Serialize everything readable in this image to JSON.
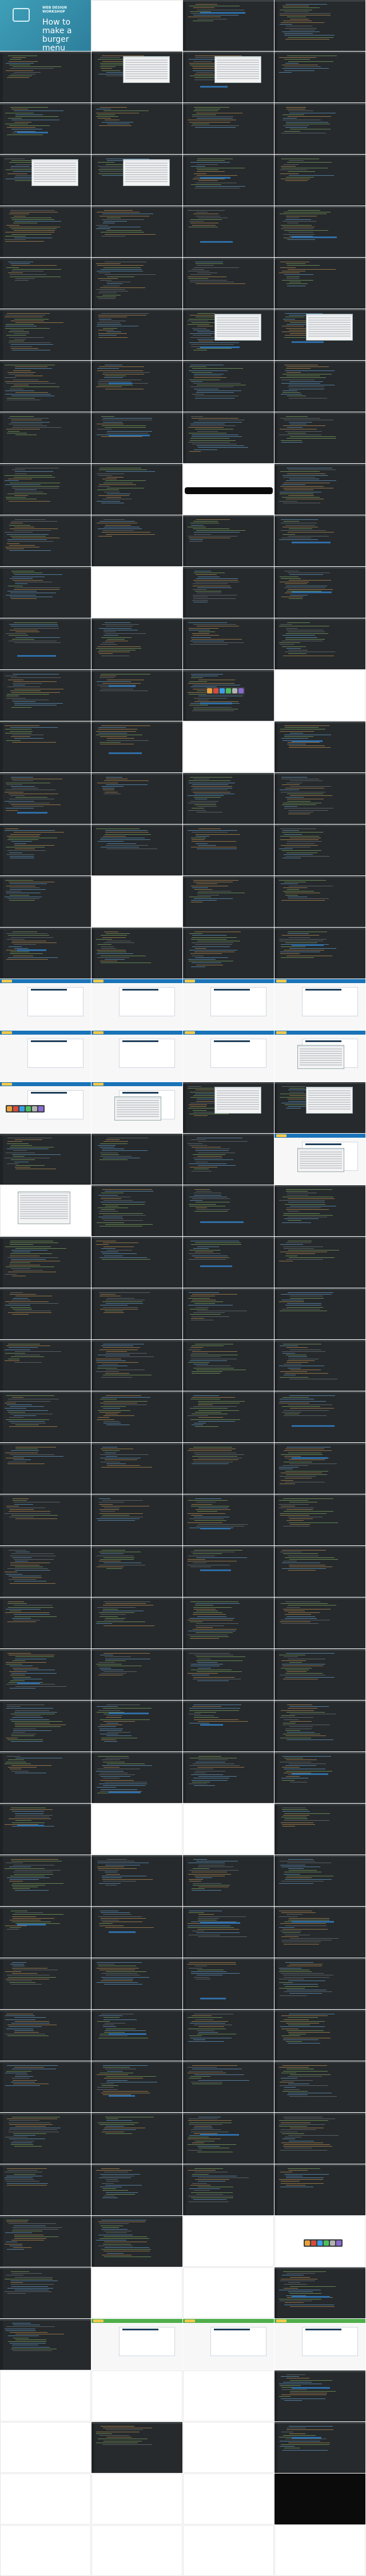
{
  "cover": {
    "brand_line_1": "WEB DESIGN",
    "brand_line_2": "WORKSHOP",
    "headline_line_1": "How to make a",
    "headline_line_2": "burger menu"
  },
  "colors": {
    "editor_bg": "#262a2c",
    "cover_bg": "#3f9fb8",
    "site_header_blue": "#1a73b8",
    "site_header_green": "#4fae4a",
    "selection_blue": "#2f6ea8"
  },
  "frames": [
    "cover",
    "blank",
    "editor",
    "editor",
    "editor",
    "editor-dialog",
    "editor-dialog",
    "editor",
    "editor",
    "editor",
    "editor",
    "editor",
    "editor-dialog",
    "editor-dialog",
    "editor",
    "editor",
    "editor",
    "editor",
    "editor",
    "editor",
    "editor",
    "editor",
    "editor",
    "editor",
    "editor",
    "editor",
    "editor-dialog",
    "editor-dialog",
    "editor",
    "editor",
    "editor",
    "editor",
    "editor",
    "editor",
    "editor",
    "editor",
    "editor",
    "editor",
    "black-bar",
    "editor",
    "editor",
    "editor",
    "editor",
    "editor",
    "editor",
    "blank",
    "editor",
    "editor",
    "editor",
    "editor",
    "editor",
    "editor",
    "editor",
    "editor",
    "editor-dock",
    "blank",
    "editor",
    "editor",
    "blank",
    "editor",
    "editor",
    "editor",
    "editor",
    "editor",
    "editor",
    "editor",
    "editor",
    "editor",
    "editor",
    "blank",
    "editor",
    "editor",
    "editor",
    "editor",
    "editor",
    "editor",
    "site",
    "site",
    "site",
    "site",
    "site",
    "site",
    "site",
    "site-dialog",
    "site-dock",
    "site-dialog",
    "editor-dialog",
    "editor-dialog",
    "editor",
    "editor",
    "editor",
    "site-dialog",
    "blank-dialog",
    "editor",
    "editor",
    "editor",
    "editor",
    "editor",
    "editor",
    "editor",
    "editor",
    "editor",
    "editor",
    "editor",
    "editor",
    "editor",
    "editor",
    "editor",
    "editor",
    "editor",
    "editor",
    "editor",
    "editor",
    "editor",
    "editor",
    "editor",
    "editor",
    "editor",
    "editor",
    "editor",
    "editor",
    "editor",
    "editor",
    "editor",
    "editor",
    "editor",
    "editor",
    "editor",
    "editor",
    "editor",
    "editor",
    "editor",
    "editor",
    "editor",
    "editor",
    "editor",
    "editor",
    "editor",
    "editor",
    "editor",
    "editor",
    "blank",
    "blank",
    "editor",
    "editor",
    "editor",
    "editor",
    "editor",
    "editor",
    "editor",
    "editor",
    "editor",
    "editor",
    "editor",
    "editor",
    "editor",
    "editor",
    "editor",
    "editor",
    "editor",
    "editor",
    "editor",
    "editor",
    "editor",
    "editor",
    "editor",
    "editor",
    "editor",
    "editor",
    "editor",
    "editor",
    "editor",
    "editor",
    "editor",
    "blank",
    "blank-dock",
    "editor",
    "blank",
    "blank",
    "editor",
    "editor",
    "site-green",
    "site-green",
    "site-green",
    "blank",
    "blank",
    "blank",
    "editor",
    "blank",
    "editor",
    "blank",
    "editor",
    "blank",
    "blank",
    "blank",
    "black",
    "blank",
    "blank",
    "blank",
    "blank"
  ]
}
